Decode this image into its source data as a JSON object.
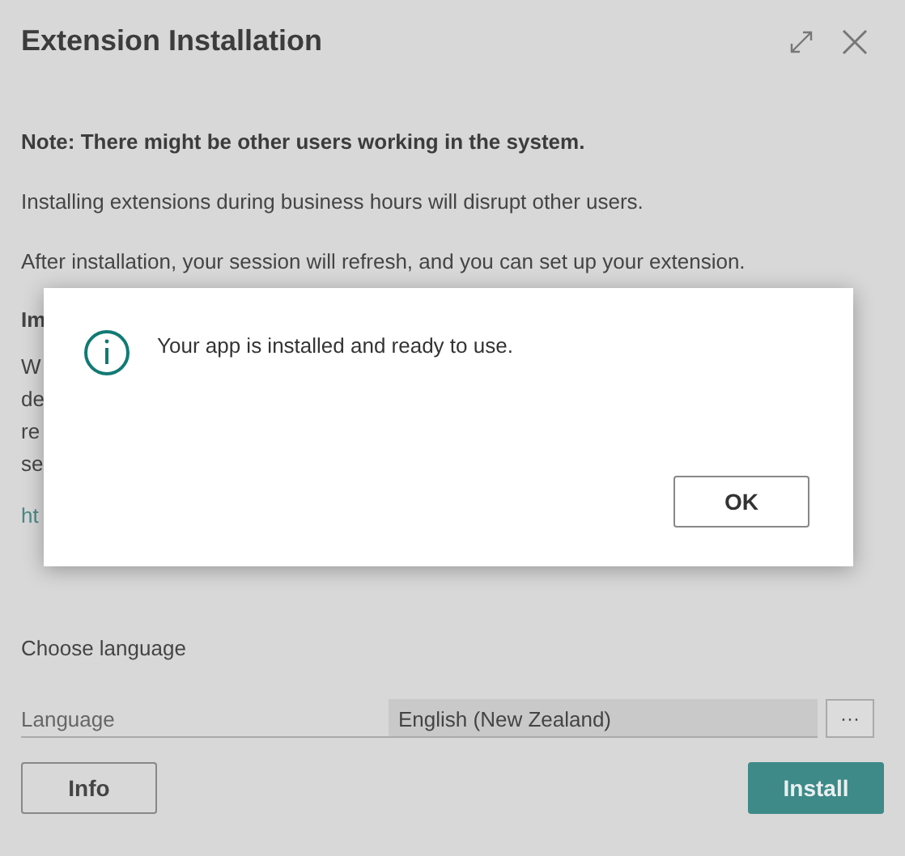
{
  "window": {
    "title": "Extension Installation"
  },
  "note": "Note: There might be other users working in the system.",
  "paragraphs": [
    "Installing extensions during business hours will disrupt other users.",
    "After installation, your session will refresh, and you can set up your extension."
  ],
  "hidden_section": {
    "heading": "Im",
    "lines": [
      "W",
      "de",
      "re",
      "se"
    ],
    "link": "ht"
  },
  "language_section": {
    "heading": "Choose language",
    "field": {
      "label": "Language",
      "value": "English (New Zealand)",
      "lookup": "···"
    }
  },
  "buttons": [
    {
      "label": "Info",
      "kind": "secondary"
    },
    {
      "label": "Install",
      "kind": "primary"
    }
  ],
  "dialog": {
    "message": "Your app is installed and ready to use.",
    "button": "OK"
  }
}
